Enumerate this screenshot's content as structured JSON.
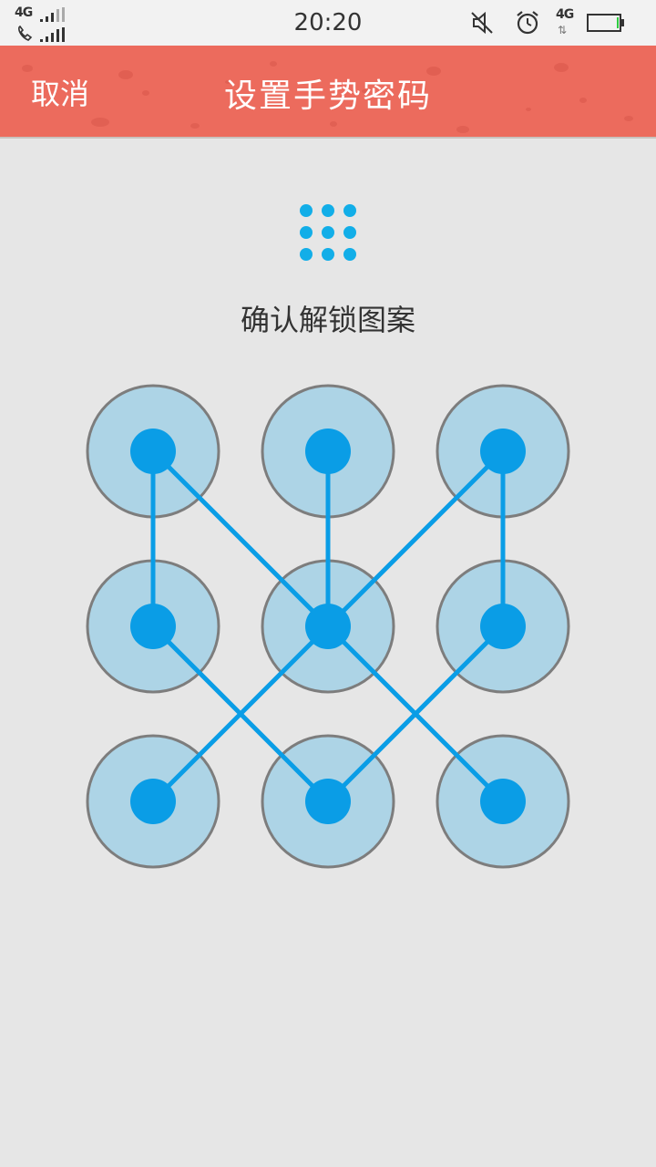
{
  "status_bar": {
    "network_left": "4G",
    "time": "20:20",
    "network_right": "4G",
    "icons": [
      "signal-icon",
      "phone-icon",
      "mute-icon",
      "alarm-icon",
      "data-arrows-icon",
      "battery-icon"
    ]
  },
  "header": {
    "cancel_label": "取消",
    "title": "设置手势密码",
    "bg_color": "#ec6b5d"
  },
  "main": {
    "prompt": "确认解锁图案",
    "icon": "dot-grid-icon",
    "accent_color": "#0a9de6"
  },
  "pattern": {
    "grid": "3x3",
    "selected_nodes": [
      1,
      2,
      3,
      4,
      5,
      6,
      7,
      8,
      9
    ],
    "segments": [
      [
        1,
        4
      ],
      [
        1,
        5
      ],
      [
        2,
        5
      ],
      [
        3,
        5
      ],
      [
        3,
        6
      ],
      [
        4,
        8
      ],
      [
        5,
        7
      ],
      [
        5,
        9
      ],
      [
        6,
        8
      ]
    ]
  }
}
